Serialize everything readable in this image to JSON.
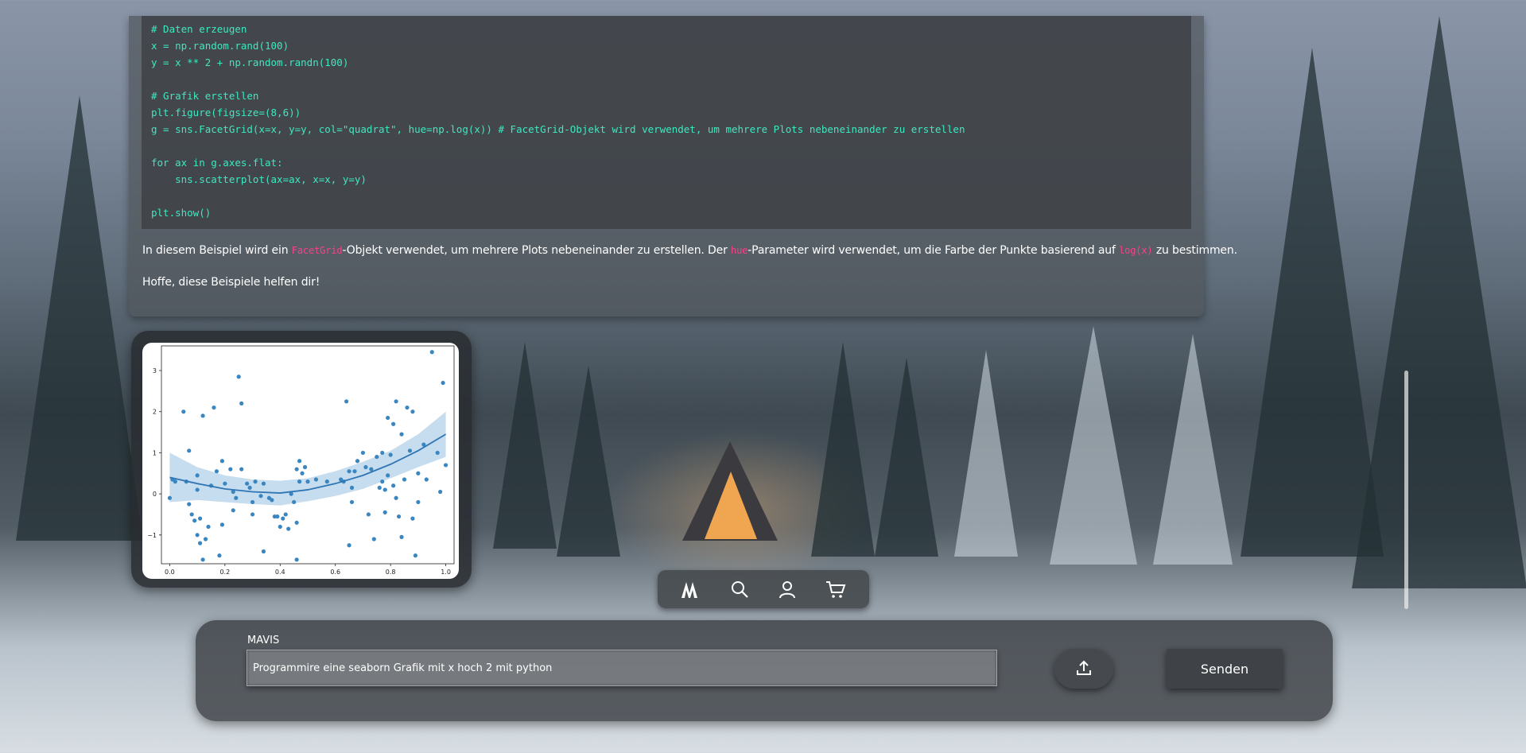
{
  "code": {
    "lines": [
      "# Daten erzeugen",
      "x = np.random.rand(100)",
      "y = x ** 2 + np.random.randn(100)",
      "",
      "# Grafik erstellen",
      "plt.figure(figsize=(8,6))",
      "g = sns.FacetGrid(x=x, y=y, col=\"quadrat\", hue=np.log(x)) # FacetGrid-Objekt wird verwendet, um mehrere Plots nebeneinander zu erstellen",
      "",
      "for ax in g.axes.flat:",
      "    sns.scatterplot(ax=ax, x=x, y=y)",
      "",
      "plt.show()"
    ]
  },
  "response": {
    "p1_a": "In diesem Beispiel wird ein ",
    "p1_code1": "FacetGrid",
    "p1_b": "-Objekt verwendet, um mehrere Plots nebeneinander zu erstellen. Der ",
    "p1_code2": "hue",
    "p1_c": "-Parameter wird verwendet, um die Farbe der Punkte basierend auf ",
    "p1_code3": "log(x)",
    "p1_d": " zu bestimmen.",
    "p2": "Hoffe, diese Beispiele helfen dir!"
  },
  "chart_data": {
    "type": "scatter",
    "xlim": [
      -0.03,
      1.03
    ],
    "ylim": [
      -1.7,
      3.6
    ],
    "xticks": [
      "0.0",
      "0.2",
      "0.4",
      "0.6",
      "0.8",
      "1.0"
    ],
    "yticks": [
      "−1",
      "0",
      "1",
      "2",
      "3"
    ],
    "points": [
      [
        0.0,
        -0.1
      ],
      [
        0.01,
        0.35
      ],
      [
        0.02,
        0.3
      ],
      [
        0.05,
        2.0
      ],
      [
        0.06,
        0.3
      ],
      [
        0.07,
        1.05
      ],
      [
        0.07,
        -0.25
      ],
      [
        0.08,
        -0.5
      ],
      [
        0.09,
        -0.65
      ],
      [
        0.1,
        0.1
      ],
      [
        0.1,
        -1.0
      ],
      [
        0.1,
        0.45
      ],
      [
        0.11,
        -1.2
      ],
      [
        0.11,
        -0.6
      ],
      [
        0.12,
        1.9
      ],
      [
        0.12,
        -1.6
      ],
      [
        0.13,
        -1.1
      ],
      [
        0.14,
        -0.8
      ],
      [
        0.15,
        0.2
      ],
      [
        0.16,
        2.1
      ],
      [
        0.17,
        0.55
      ],
      [
        0.18,
        -1.5
      ],
      [
        0.19,
        0.8
      ],
      [
        0.19,
        -0.75
      ],
      [
        0.2,
        0.25
      ],
      [
        0.22,
        0.6
      ],
      [
        0.23,
        -0.4
      ],
      [
        0.23,
        0.05
      ],
      [
        0.24,
        -0.1
      ],
      [
        0.25,
        2.85
      ],
      [
        0.26,
        2.2
      ],
      [
        0.26,
        0.6
      ],
      [
        0.28,
        0.25
      ],
      [
        0.29,
        0.15
      ],
      [
        0.3,
        -0.2
      ],
      [
        0.3,
        -0.5
      ],
      [
        0.31,
        0.3
      ],
      [
        0.33,
        -0.05
      ],
      [
        0.34,
        0.25
      ],
      [
        0.34,
        -1.4
      ],
      [
        0.36,
        -0.1
      ],
      [
        0.37,
        -0.15
      ],
      [
        0.38,
        -0.55
      ],
      [
        0.39,
        -0.55
      ],
      [
        0.4,
        -0.8
      ],
      [
        0.41,
        -0.6
      ],
      [
        0.42,
        -0.5
      ],
      [
        0.43,
        -0.85
      ],
      [
        0.44,
        0.0
      ],
      [
        0.45,
        -0.2
      ],
      [
        0.46,
        -0.7
      ],
      [
        0.46,
        0.6
      ],
      [
        0.46,
        -1.6
      ],
      [
        0.47,
        0.8
      ],
      [
        0.47,
        0.3
      ],
      [
        0.48,
        0.5
      ],
      [
        0.49,
        0.65
      ],
      [
        0.5,
        0.3
      ],
      [
        0.53,
        0.35
      ],
      [
        0.57,
        0.3
      ],
      [
        0.62,
        0.35
      ],
      [
        0.63,
        0.3
      ],
      [
        0.64,
        2.25
      ],
      [
        0.65,
        0.55
      ],
      [
        0.65,
        -1.25
      ],
      [
        0.66,
        0.15
      ],
      [
        0.66,
        -0.2
      ],
      [
        0.67,
        0.55
      ],
      [
        0.68,
        0.8
      ],
      [
        0.7,
        1.0
      ],
      [
        0.71,
        0.65
      ],
      [
        0.72,
        -0.5
      ],
      [
        0.73,
        0.6
      ],
      [
        0.74,
        -1.1
      ],
      [
        0.75,
        0.9
      ],
      [
        0.76,
        0.15
      ],
      [
        0.77,
        0.3
      ],
      [
        0.77,
        1.0
      ],
      [
        0.78,
        0.1
      ],
      [
        0.78,
        -0.45
      ],
      [
        0.79,
        1.85
      ],
      [
        0.79,
        0.45
      ],
      [
        0.8,
        0.95
      ],
      [
        0.81,
        1.7
      ],
      [
        0.81,
        0.2
      ],
      [
        0.82,
        2.25
      ],
      [
        0.82,
        -0.1
      ],
      [
        0.83,
        -0.55
      ],
      [
        0.84,
        -1.05
      ],
      [
        0.84,
        1.45
      ],
      [
        0.85,
        0.35
      ],
      [
        0.86,
        2.1
      ],
      [
        0.87,
        1.05
      ],
      [
        0.88,
        2.0
      ],
      [
        0.88,
        -0.6
      ],
      [
        0.89,
        -1.5
      ],
      [
        0.9,
        -0.2
      ],
      [
        0.9,
        0.5
      ],
      [
        0.92,
        1.2
      ],
      [
        0.93,
        0.35
      ],
      [
        0.95,
        3.45
      ],
      [
        0.97,
        1.0
      ],
      [
        0.98,
        0.05
      ],
      [
        0.99,
        2.7
      ],
      [
        1.0,
        0.7
      ]
    ],
    "regression": [
      [
        0.0,
        0.4
      ],
      [
        0.1,
        0.25
      ],
      [
        0.2,
        0.12
      ],
      [
        0.3,
        0.05
      ],
      [
        0.4,
        0.02
      ],
      [
        0.5,
        0.1
      ],
      [
        0.6,
        0.25
      ],
      [
        0.7,
        0.45
      ],
      [
        0.8,
        0.72
      ],
      [
        0.9,
        1.05
      ],
      [
        1.0,
        1.45
      ]
    ],
    "ci_band_upper": [
      [
        0.0,
        1.0
      ],
      [
        0.1,
        0.65
      ],
      [
        0.2,
        0.45
      ],
      [
        0.3,
        0.35
      ],
      [
        0.4,
        0.32
      ],
      [
        0.5,
        0.38
      ],
      [
        0.6,
        0.55
      ],
      [
        0.7,
        0.78
      ],
      [
        0.8,
        1.05
      ],
      [
        0.9,
        1.45
      ],
      [
        1.0,
        2.0
      ]
    ],
    "ci_band_lower": [
      [
        0.0,
        -0.2
      ],
      [
        0.1,
        -0.15
      ],
      [
        0.2,
        -0.2
      ],
      [
        0.3,
        -0.25
      ],
      [
        0.4,
        -0.28
      ],
      [
        0.5,
        -0.18
      ],
      [
        0.6,
        -0.05
      ],
      [
        0.7,
        0.12
      ],
      [
        0.8,
        0.38
      ],
      [
        0.9,
        0.65
      ],
      [
        1.0,
        0.9
      ]
    ],
    "point_color": "#3a86c0",
    "line_color": "#2f76b4",
    "band_color": "#aecde8"
  },
  "nav": {
    "items": [
      "logo-icon",
      "search-icon",
      "user-icon",
      "cart-icon"
    ]
  },
  "chat_input": {
    "label": "MAVIS",
    "value": "Programmire eine seaborn Grafik mit x hoch 2 mit python",
    "upload_icon": "upload-icon",
    "send_label": "Senden"
  }
}
